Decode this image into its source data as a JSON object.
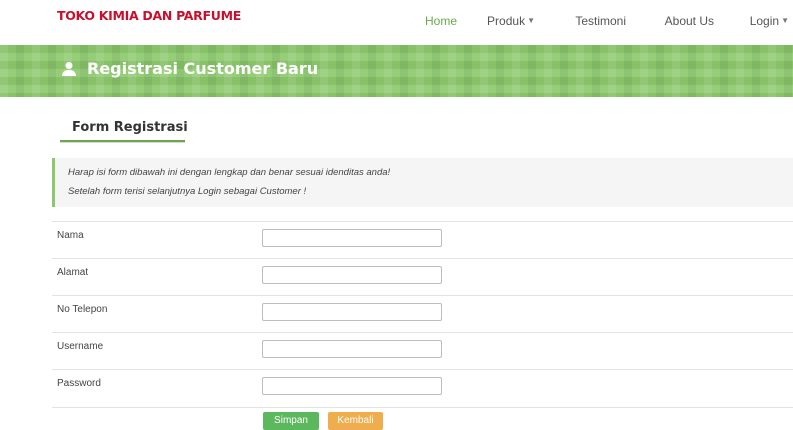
{
  "navbar": {
    "brand": "TOKO KIMIA DAN PARFUME",
    "items": [
      {
        "label": "Home",
        "active": true,
        "has_dropdown": false
      },
      {
        "label": "Produk",
        "active": false,
        "has_dropdown": true
      },
      {
        "label": "Testimoni",
        "active": false,
        "has_dropdown": false
      },
      {
        "label": "About Us",
        "active": false,
        "has_dropdown": false
      },
      {
        "label": "Login",
        "active": false,
        "has_dropdown": true
      }
    ],
    "caret": "▼"
  },
  "banner": {
    "title": "Registrasi Customer Baru",
    "icon": "user-icon",
    "color": "#8cc96c"
  },
  "section": {
    "title": "Form Registrasi"
  },
  "notice": {
    "line1": "Harap isi form dibawah ini dengan lengkap dan benar sesuai idenditas anda!",
    "line2": "Setelah form terisi selanjutnya Login sebagai Customer !"
  },
  "form": {
    "fields": [
      {
        "label": "Nama",
        "value": ""
      },
      {
        "label": "Alamat",
        "value": ""
      },
      {
        "label": "No Telepon",
        "value": ""
      },
      {
        "label": "Username",
        "value": ""
      },
      {
        "label": "Password",
        "value": ""
      }
    ],
    "save_label": "Simpan",
    "back_label": "Kembali"
  },
  "colors": {
    "brand": "#c8102e",
    "accent": "#6aa84f",
    "save": "#5cb85c",
    "back": "#f0ad4e"
  }
}
